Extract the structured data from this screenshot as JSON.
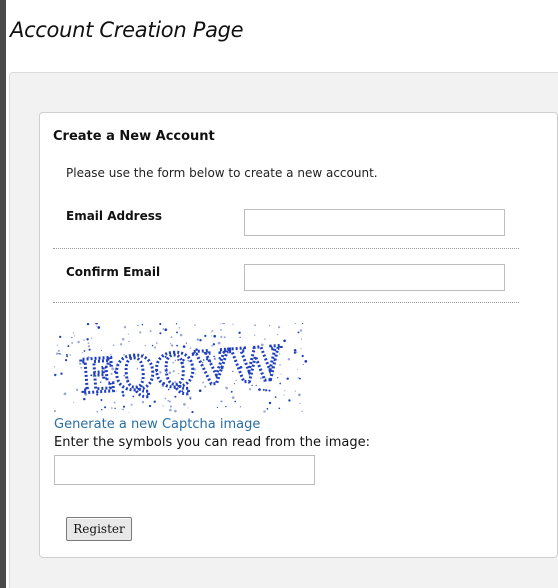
{
  "page": {
    "title": "Account Creation Page"
  },
  "form": {
    "heading": "Create a New Account",
    "intro": "Please use the form below to create a new account.",
    "email_label": "Email Address",
    "email_value": "",
    "confirm_label": "Confirm Email",
    "confirm_value": "",
    "captcha_text": "EQQVW",
    "captcha_link": "Generate a new Captcha image",
    "captcha_instruction": "Enter the symbols you can read from the image:",
    "captcha_value": "",
    "register_label": "Register"
  },
  "colors": {
    "captcha_ink": "#1f3fbf",
    "link": "#2a6ea6"
  }
}
